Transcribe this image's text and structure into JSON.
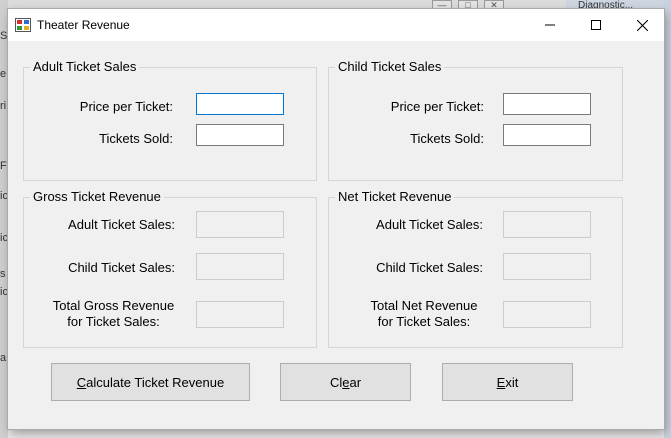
{
  "window": {
    "title": "Theater Revenue"
  },
  "background": {
    "left_letters": [
      "S",
      "e",
      "ri",
      "F",
      "ic",
      "ic",
      "s",
      "ic",
      "a"
    ],
    "right_strip_text": "Diagnostic..."
  },
  "adult_sales": {
    "legend": "Adult Ticket Sales",
    "price_label": "Price per Ticket:",
    "sold_label": "Tickets Sold:",
    "price_value": "",
    "sold_value": ""
  },
  "child_sales": {
    "legend": "Child Ticket Sales",
    "price_label": "Price per Ticket:",
    "sold_label": "Tickets Sold:",
    "price_value": "",
    "sold_value": ""
  },
  "gross": {
    "legend": "Gross Ticket Revenue",
    "adult_label": "Adult Ticket Sales:",
    "child_label": "Child Ticket Sales:",
    "total_label_line1": "Total Gross Revenue",
    "total_label_line2": "for Ticket Sales:",
    "adult_value": "",
    "child_value": "",
    "total_value": ""
  },
  "net": {
    "legend": "Net Ticket Revenue",
    "adult_label": "Adult Ticket Sales:",
    "child_label": "Child Ticket Sales:",
    "total_label_line1": "Total Net Revenue",
    "total_label_line2": "for Ticket Sales:",
    "adult_value": "",
    "child_value": "",
    "total_value": ""
  },
  "buttons": {
    "calculate_mnemonic": "C",
    "calculate_rest": "alculate Ticket Revenue",
    "clear_pre": "Cl",
    "clear_mnemonic": "e",
    "clear_rest": "ar",
    "exit_mnemonic": "E",
    "exit_rest": "xit"
  }
}
